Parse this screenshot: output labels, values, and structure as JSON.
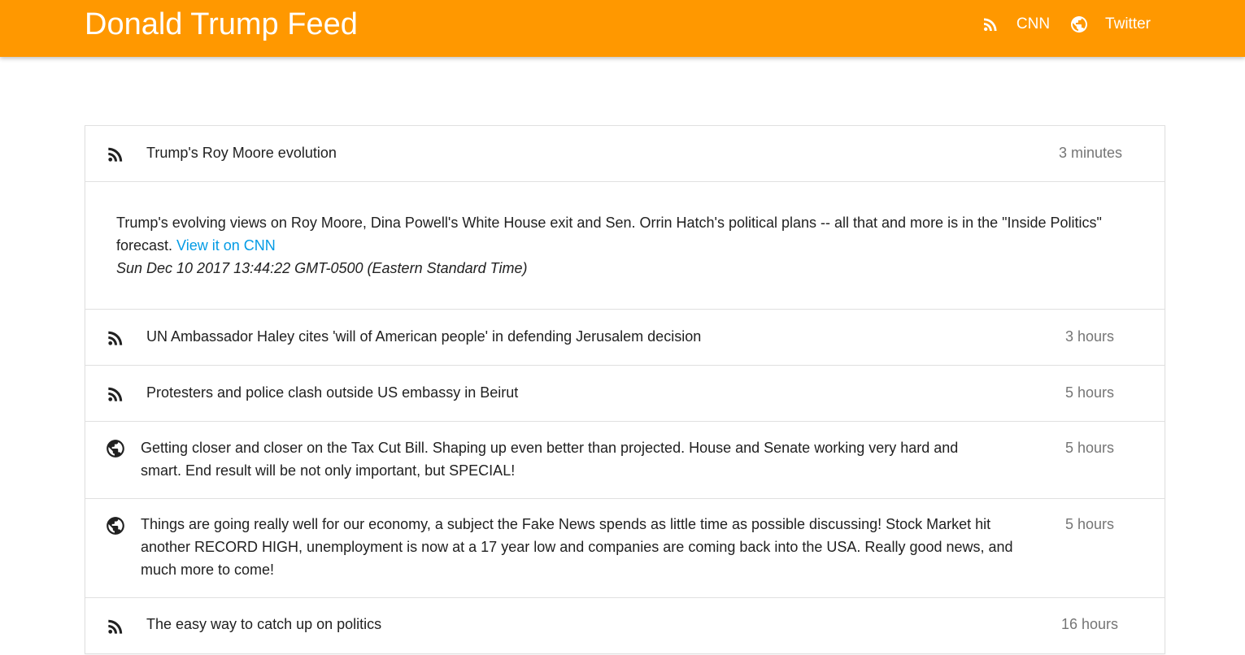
{
  "app": {
    "title": "Donald Trump Feed",
    "accent_color": "#ff9800"
  },
  "nav": {
    "links": [
      {
        "label": "CNN",
        "icon": "rss-icon"
      },
      {
        "label": "Twitter",
        "icon": "globe-icon"
      }
    ]
  },
  "feed": {
    "items": [
      {
        "source": "rss",
        "icon": "rss-icon",
        "title": "Trump's Roy Moore evolution",
        "time": "3 minutes",
        "expanded": true,
        "description": "Trump's evolving views on Roy Moore, Dina Powell's White House exit and Sen. Orrin Hatch's political plans -- all that and more is in the \"Inside Politics\" forecast.",
        "link_label": "View it on CNN",
        "date": "Sun Dec 10 2017 13:44:22 GMT-0500 (Eastern Standard Time)"
      },
      {
        "source": "rss",
        "icon": "rss-icon",
        "title": "UN Ambassador Haley cites 'will of American people' in defending Jerusalem decision",
        "time": "3 hours"
      },
      {
        "source": "rss",
        "icon": "rss-icon",
        "title": "Protesters and police clash outside US embassy in Beirut",
        "time": "5 hours"
      },
      {
        "source": "twitter",
        "icon": "globe-icon",
        "title": "Getting closer and closer on the Tax Cut Bill. Shaping up even better than projected. House and Senate working very hard and smart. End result will be not only important, but SPECIAL!",
        "time": "5 hours"
      },
      {
        "source": "twitter",
        "icon": "globe-icon",
        "title": "Things are going really well for our economy, a subject the Fake News spends as little time as possible discussing! Stock Market hit another RECORD HIGH, unemployment is now at a 17 year low and companies are coming back into the USA. Really good news, and much more to come!",
        "time": "5 hours"
      },
      {
        "source": "rss",
        "icon": "rss-icon",
        "title": "The easy way to catch up on politics",
        "time": "16 hours"
      }
    ]
  }
}
